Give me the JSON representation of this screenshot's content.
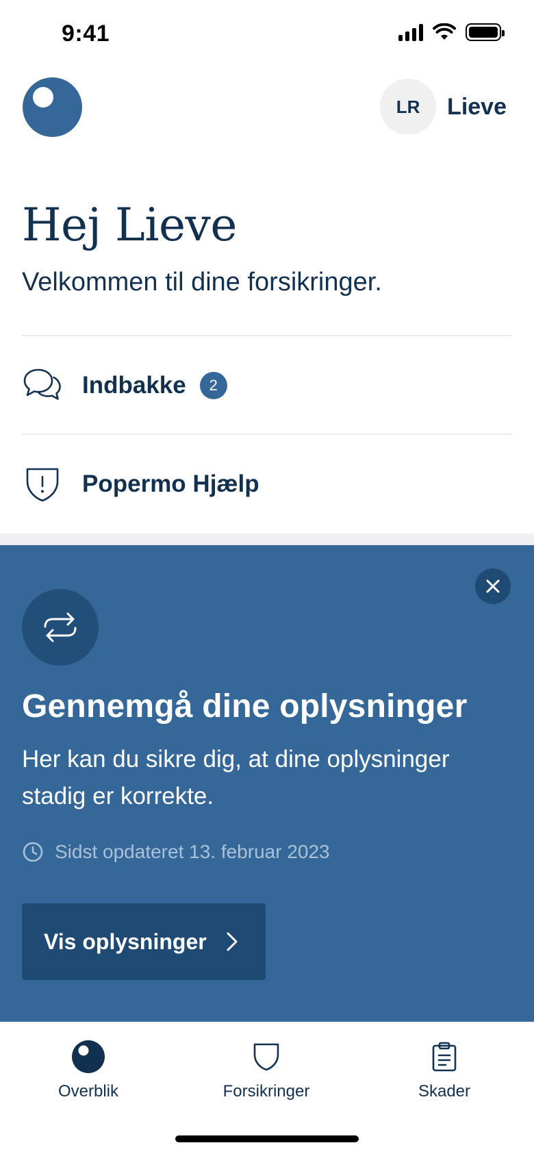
{
  "status_bar": {
    "time": "9:41"
  },
  "header": {
    "avatar_initials": "LR",
    "user_name": "Lieve"
  },
  "greeting": {
    "title": "Hej Lieve",
    "subtitle": "Velkommen til dine forsikringer."
  },
  "menu": {
    "items": [
      {
        "label": "Indbakke",
        "icon": "chat-bubbles-icon",
        "badge": "2"
      },
      {
        "label": "Popermo Hjælp",
        "icon": "shield-alert-icon"
      }
    ]
  },
  "card": {
    "icon": "refresh-icon",
    "title": "Gennemgå dine oplysninger",
    "body": "Her kan du sikre dig, at dine oplysninger stadig er korrekte.",
    "updated": "Sidst opdateret 13. februar 2023",
    "cta_label": "Vis oplysninger"
  },
  "tab_bar": {
    "tabs": [
      {
        "label": "Overblik",
        "icon": "overview-logo-icon",
        "active": true
      },
      {
        "label": "Forsikringer",
        "icon": "shield-icon",
        "active": false
      },
      {
        "label": "Skader",
        "icon": "clipboard-icon",
        "active": false
      }
    ]
  },
  "colors": {
    "brand": "#356899",
    "brand_dark": "#1f4a73",
    "text": "#12304f"
  }
}
